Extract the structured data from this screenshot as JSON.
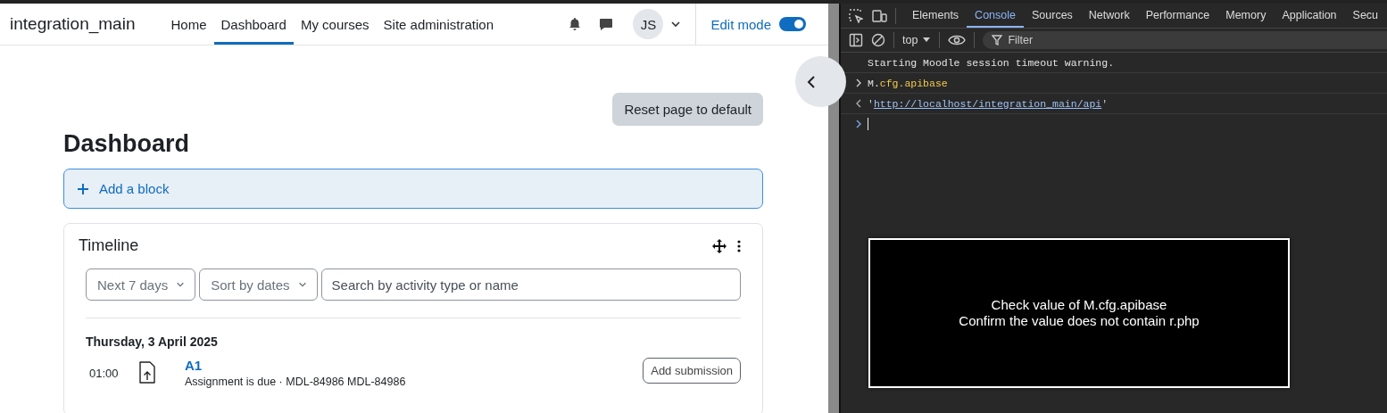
{
  "navbar": {
    "site_name": "integration_main",
    "nav_items": [
      {
        "label": "Home",
        "selected": false
      },
      {
        "label": "Dashboard",
        "selected": true
      },
      {
        "label": "My courses",
        "selected": false
      },
      {
        "label": "Site administration",
        "selected": false
      }
    ],
    "user_initials": "JS",
    "edit_mode": {
      "label": "Edit mode",
      "on": true
    }
  },
  "page": {
    "reset_button": "Reset page to default",
    "title": "Dashboard",
    "add_block": "Add a block",
    "timeline": {
      "title": "Timeline",
      "filters": [
        {
          "label": "Next 7 days"
        },
        {
          "label": "Sort by dates"
        }
      ],
      "search": {
        "placeholder": "Search by activity type or name"
      },
      "date_heading": "Thursday, 3 April 2025",
      "events": [
        {
          "time": "01:00",
          "name": "A1",
          "description": "Assignment is due · MDL-84986 MDL-84986",
          "action": "Add submission"
        }
      ]
    }
  },
  "devtools": {
    "tabs": [
      {
        "label": "Elements",
        "selected": false
      },
      {
        "label": "Console",
        "selected": true
      },
      {
        "label": "Sources",
        "selected": false
      },
      {
        "label": "Network",
        "selected": false
      },
      {
        "label": "Performance",
        "selected": false
      },
      {
        "label": "Memory",
        "selected": false
      },
      {
        "label": "Application",
        "selected": false
      },
      {
        "label": "Secu",
        "selected": false
      }
    ],
    "context": "top",
    "filter_placeholder": "Filter",
    "console": [
      {
        "kind": "log",
        "text": "Starting Moodle session timeout warning."
      },
      {
        "kind": "input",
        "parts": [
          {
            "kind": "plain",
            "text": "M."
          },
          {
            "kind": "property",
            "text": "cfg.apibase"
          }
        ]
      },
      {
        "kind": "result",
        "quote": "'",
        "link": "http://localhost/integration_main/api"
      },
      {
        "kind": "prompt"
      }
    ]
  },
  "overlay": {
    "lines": [
      "Check value of M.cfg.apibase",
      "Confirm the value does not contain r.php"
    ]
  }
}
